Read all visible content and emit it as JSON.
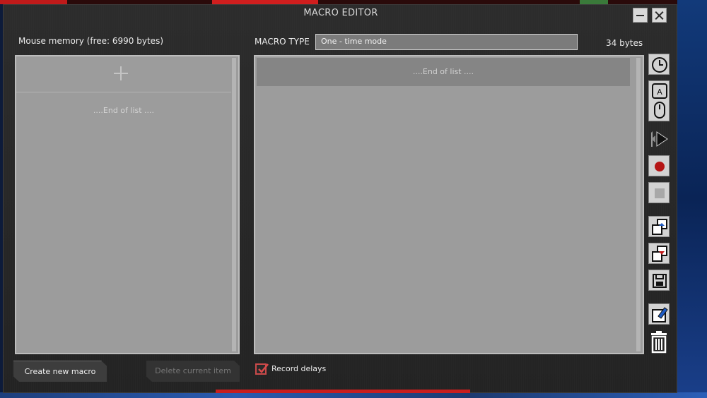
{
  "window": {
    "title": "MACRO EDITOR"
  },
  "left_panel": {
    "memory_label": "Mouse memory (free: 6990 bytes)",
    "end_of_list": "....End of list ...."
  },
  "right_panel": {
    "macro_type_label": "MACRO TYPE",
    "macro_type_value": "One - time mode",
    "bytes_label": "34 bytes",
    "end_of_list": "....End of list ...."
  },
  "buttons": {
    "create": "Create new macro",
    "delete": "Delete current item"
  },
  "options": {
    "record_delays_label": "Record delays",
    "record_delays_checked": true
  },
  "toolbar_icons": [
    "clock-icon",
    "keyboard-mouse-icon",
    "play-icon",
    "record-icon",
    "stop-icon",
    "copy-icon",
    "paste-icon",
    "save-icon",
    "edit-icon",
    "trash-icon"
  ],
  "colors": {
    "accent_red": "#c81e1e",
    "panel_gray": "#9c9c9c",
    "window_bg": "#262626"
  }
}
